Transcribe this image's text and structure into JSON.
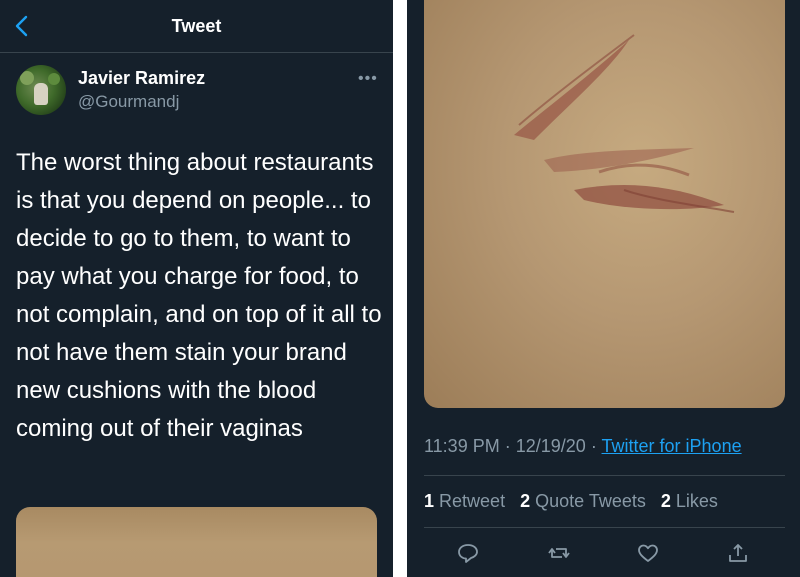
{
  "header": {
    "title": "Tweet"
  },
  "author": {
    "name": "Javier Ramirez",
    "handle": "@Gourmandj"
  },
  "tweet": {
    "text": "The worst thing about restaurants is that you depend on people... to decide to go to them, to want to pay what you charge for food, to not complain, and on top of it all to not have them stain your brand new cushions with the blood coming out of their vaginas",
    "time": "11:39 PM",
    "date": "12/19/20",
    "separator": "·",
    "source": "Twitter for iPhone"
  },
  "stats": {
    "retweets_count": "1",
    "retweets_label": "Retweet",
    "quote_count": "2",
    "quote_label": "Quote Tweets",
    "likes_count": "2",
    "likes_label": "Likes"
  },
  "icons": {
    "back": "chevron-left-icon",
    "more": "more-dots-icon",
    "reply": "reply-icon",
    "retweet": "retweet-icon",
    "like": "heart-icon",
    "share": "share-icon"
  },
  "colors": {
    "background": "#15202b",
    "accent": "#1da1f2",
    "muted": "#8899a6",
    "divider": "#38444d"
  }
}
